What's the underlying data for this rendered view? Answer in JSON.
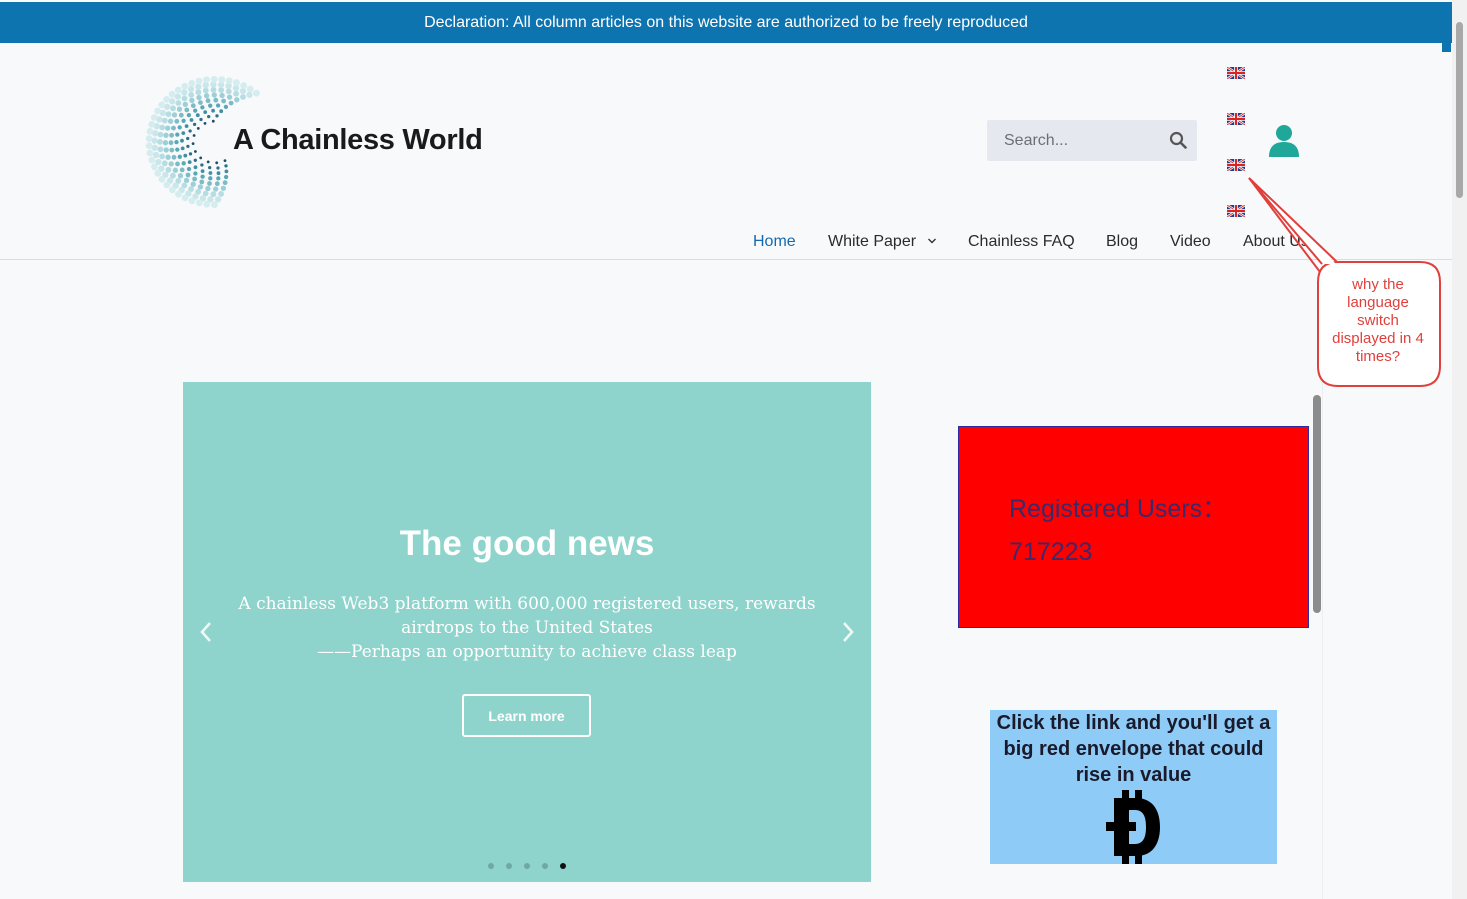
{
  "banner": {
    "text": "Declaration: All column articles on this website are authorized to be freely reproduced"
  },
  "logo": {
    "text": "A Chainless World"
  },
  "search": {
    "placeholder": "Search..."
  },
  "nav": {
    "items": [
      "Home",
      "White Paper",
      "Chainless FAQ",
      "Blog",
      "Video",
      "About Us"
    ],
    "active": "Home",
    "dropdown_item": "White Paper"
  },
  "language_flags": {
    "icon": "uk-flag-icon",
    "count": 4
  },
  "slider": {
    "title": "The good news",
    "lines": [
      "A chainless Web3 platform with 600,000 registered users, rewards",
      "airdrops to the United States",
      "——Perhaps an opportunity to achieve class leap"
    ],
    "button_label": "Learn more",
    "slide_count": 5,
    "active_slide": 5,
    "background": "#8ed4cc"
  },
  "stats": {
    "label": "Registered Users：",
    "count": "717223",
    "background": "#ff0000"
  },
  "promo": {
    "lines": [
      "Click the link and you'll get a",
      "big red envelope that could",
      "rise in value"
    ],
    "icon": "dogecoin-icon"
  },
  "annotation": {
    "lines": [
      "why the",
      "language",
      "switch",
      "displayed in 4",
      "times?"
    ],
    "color": "#e0403c"
  },
  "colors": {
    "banner": "#0d74b0",
    "accent": "#1569b0",
    "user_icon": "#1fa79a"
  }
}
